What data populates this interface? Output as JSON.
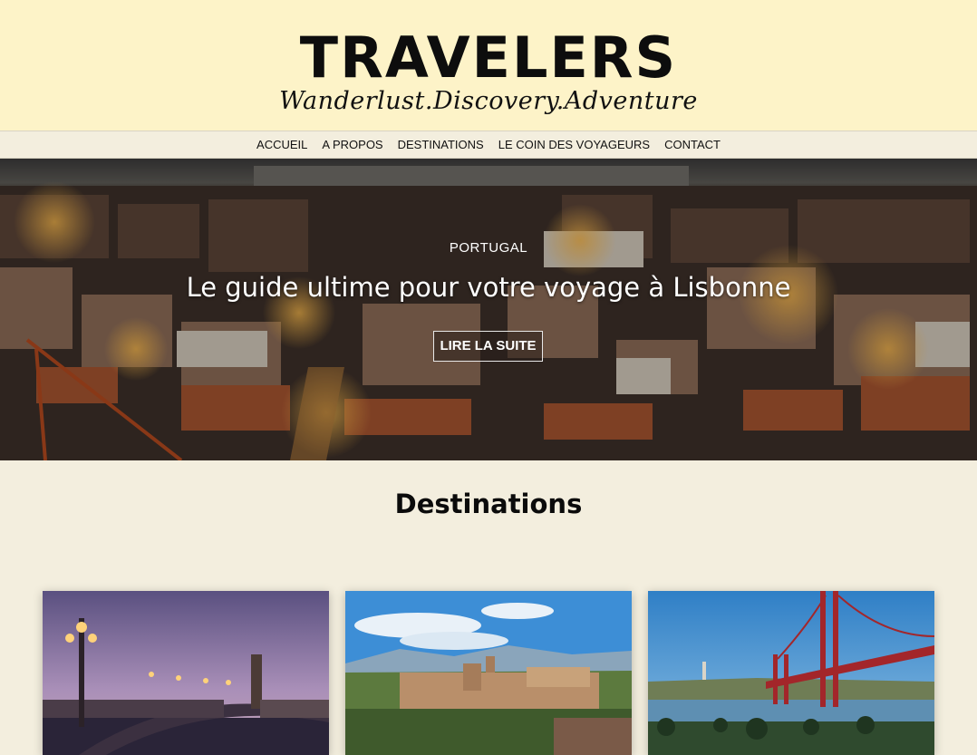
{
  "site": {
    "title": "TRAVELERS",
    "tagline": "Wanderlust.Discovery.Adventure"
  },
  "nav": {
    "items": [
      {
        "label": "ACCUEIL"
      },
      {
        "label": "A PROPOS"
      },
      {
        "label": "DESTINATIONS"
      },
      {
        "label": "LE COIN DES VOYAGEURS"
      },
      {
        "label": "CONTACT"
      }
    ]
  },
  "hero": {
    "kicker": "PORTUGAL",
    "title": "Le guide ultime pour votre voyage à Lisbonne",
    "button_label": "LIRE LA SUITE"
  },
  "destinations": {
    "heading": "Destinations"
  },
  "colors": {
    "header_bg": "#fdf3c8",
    "page_bg": "#f3eede",
    "text": "#0d0d0d"
  }
}
